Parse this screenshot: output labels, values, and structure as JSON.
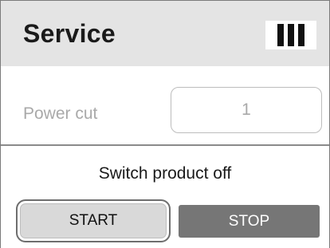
{
  "header": {
    "title": "Service",
    "signal_icon": "signal-bars-icon"
  },
  "power_cut": {
    "label": "Power cut",
    "value": "1"
  },
  "switch": {
    "label": "Switch product off",
    "start_label": "START",
    "stop_label": "STOP"
  },
  "colors": {
    "header_bg": "#e4e4e4",
    "stop_button_bg": "#767676",
    "start_button_bg": "#d9d9d9"
  }
}
